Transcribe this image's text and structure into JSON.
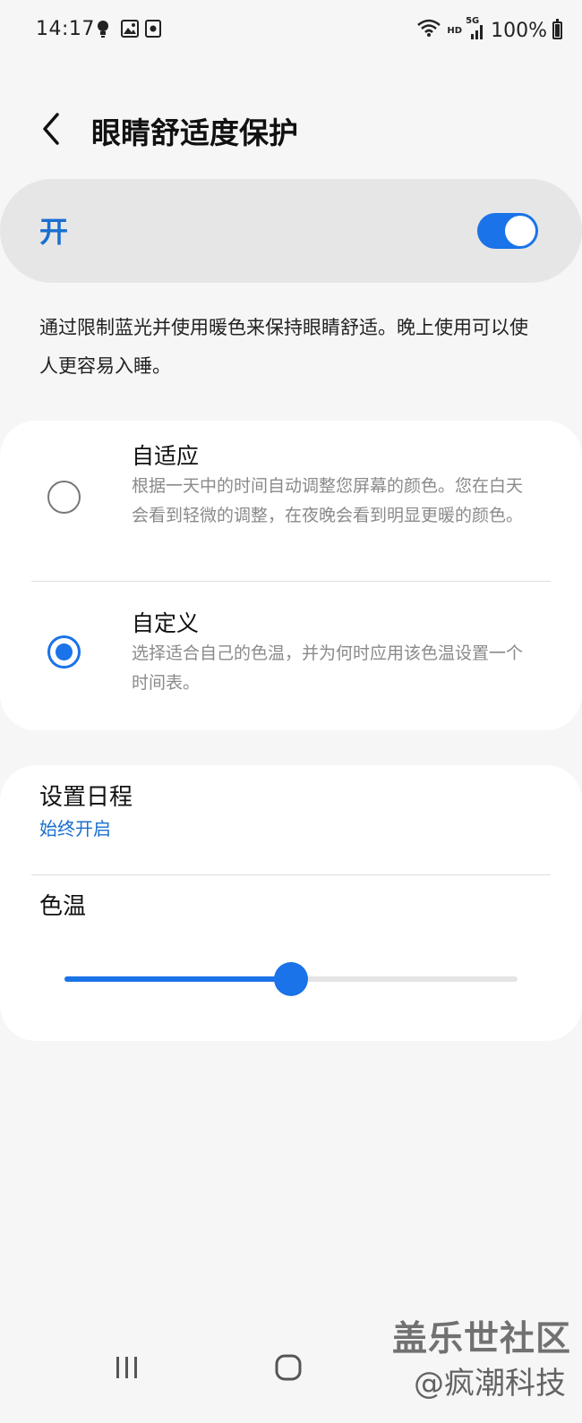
{
  "status_bar": {
    "time": "14:17",
    "network_tag": "HD",
    "cell_tag": "5G",
    "battery_text": "100%",
    "left_icons": [
      "notification-bulb-icon",
      "gallery-icon",
      "screen-recorder-icon"
    ],
    "right_icons": [
      "wifi-icon",
      "signal-icon",
      "battery-icon"
    ]
  },
  "header": {
    "back_icon": "chevron-left-icon",
    "title": "眼睛舒适度保护"
  },
  "master": {
    "label": "开",
    "enabled": true
  },
  "description": "通过限制蓝光并使用暖色来保持眼睛舒适。晚上使用可以使人更容易入睡。",
  "modes": [
    {
      "title": "自适应",
      "description": "根据一天中的时间自动调整您屏幕的颜色。您在白天会看到轻微的调整，在夜晚会看到明显更暖的颜色。",
      "selected": false
    },
    {
      "title": "自定义",
      "description": "选择适合自己的色温，并为何时应用该色温设置一个时间表。",
      "selected": true
    }
  ],
  "schedule": {
    "title": "设置日程",
    "value": "始终开启"
  },
  "color_temp": {
    "title": "色温",
    "level": 0.5
  },
  "nav": {
    "icons": [
      "recent-apps-icon",
      "home-icon",
      "back-icon"
    ]
  },
  "watermark": {
    "line1": "盖乐世社区",
    "line2": "@疯潮科技"
  },
  "colors": {
    "accent": "#1a73e8",
    "accent_text": "#1a6fd0",
    "background": "#f6f6f6",
    "card": "#ffffff"
  }
}
